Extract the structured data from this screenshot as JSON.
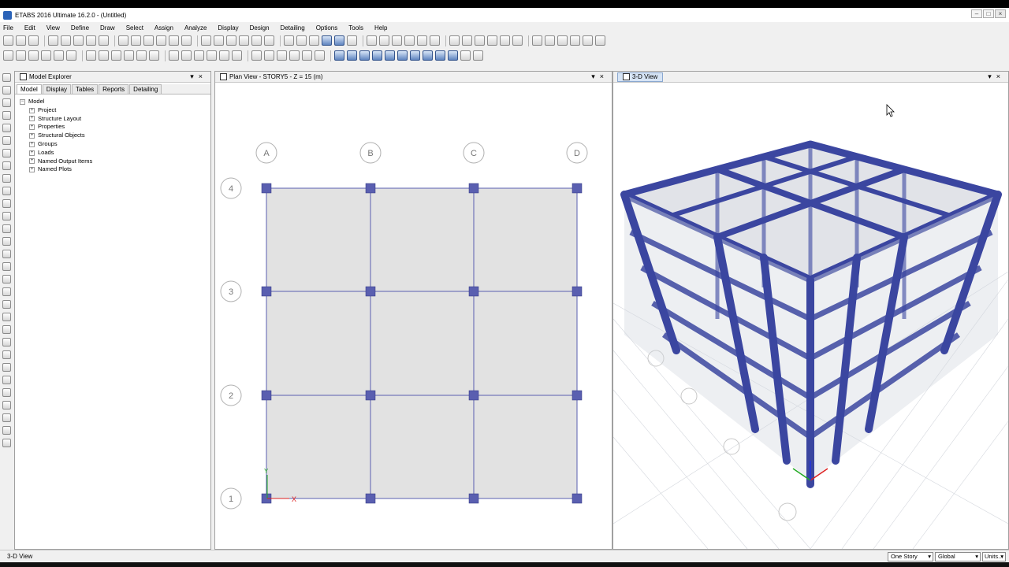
{
  "app": {
    "title": "ETABS 2016 Ultimate 16.2.0 - (Untitled)"
  },
  "menu": [
    "File",
    "Edit",
    "View",
    "Define",
    "Draw",
    "Select",
    "Assign",
    "Analyze",
    "Display",
    "Design",
    "Detailing",
    "Options",
    "Tools",
    "Help"
  ],
  "explorer": {
    "title": "Model Explorer",
    "tabs": [
      "Model",
      "Display",
      "Tables",
      "Reports",
      "Detailing"
    ],
    "root": "Model",
    "items": [
      "Project",
      "Structure Layout",
      "Properties",
      "Structural Objects",
      "Groups",
      "Loads",
      "Named Output Items",
      "Named Plots"
    ]
  },
  "plan": {
    "title": "Plan View - STORY5 - Z = 15 (m)",
    "grid_x": [
      "A",
      "B",
      "C",
      "D"
    ],
    "grid_y": [
      "4",
      "3",
      "2",
      "1"
    ],
    "axis_x": "X",
    "axis_y": "Y"
  },
  "view3d": {
    "title": "3-D View"
  },
  "status": {
    "text": "3-D View",
    "story": "One Story",
    "coord": "Global",
    "units": "Units..."
  },
  "colors": {
    "frame": "#3b46a0",
    "slab": "#e2e2e2",
    "accent": "#d6e4f5"
  }
}
